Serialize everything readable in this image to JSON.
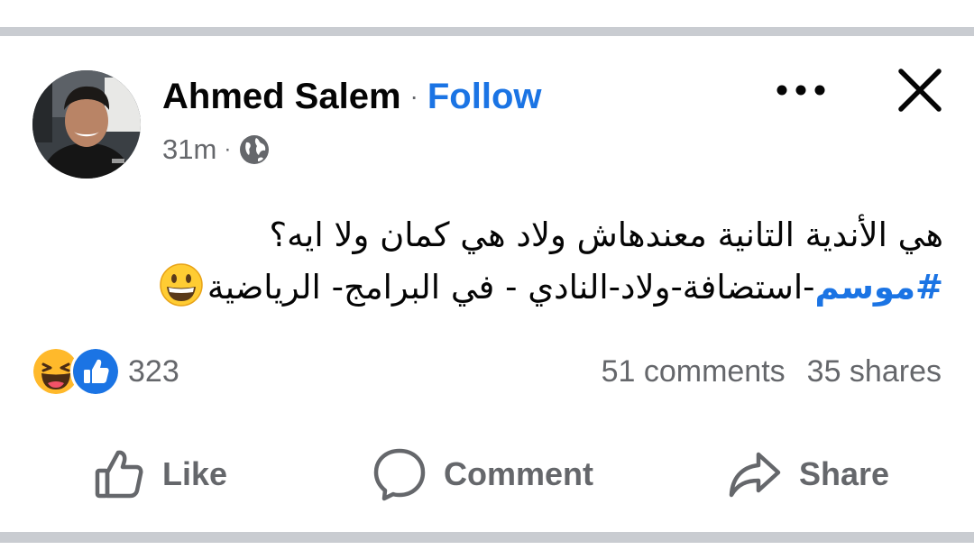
{
  "post": {
    "author": "Ahmed Salem",
    "separator": "·",
    "follow_label": "Follow",
    "time": "31m",
    "privacy_icon": "globe-icon",
    "menu_icon": "more-horizontal-icon",
    "close_icon": "close-icon",
    "text_line_1": "هي الأندية التانية معندهاش ولاد هي كمان ولا ايه؟",
    "hashtag": "#موسم",
    "text_line_2": "-استضافة-ولاد-النادي - في البرامج- الرياضية",
    "line_2_emoji": "grinning-face-emoji"
  },
  "reactions": {
    "icons": [
      "laughing-face-emoji",
      "like-reaction-icon"
    ],
    "count": "323"
  },
  "engagement": {
    "comments": "51 comments",
    "shares": "35 shares"
  },
  "actions": [
    {
      "label": "Like",
      "icon": "thumbs-up-icon"
    },
    {
      "label": "Comment",
      "icon": "comment-bubble-icon"
    },
    {
      "label": "Share",
      "icon": "share-arrow-icon"
    }
  ],
  "colors": {
    "link_blue": "#1b74e4",
    "secondary_text": "#65676b",
    "divider": "#c9ccd1"
  }
}
